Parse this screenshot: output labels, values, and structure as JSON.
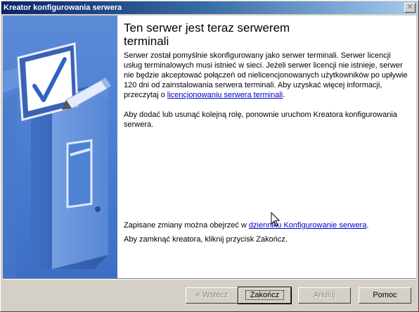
{
  "window": {
    "title": "Kreator konfigurowania serwera"
  },
  "main": {
    "title_line1": "Ten serwer jest teraz serwerem",
    "title_line2": "terminali",
    "para1_text": "Serwer został pomyślnie skonfigurowany jako serwer terminali. Serwer licencji usług terminalowych musi istnieć w sieci. Jeżeli serwer licencji nie istnieje, serwer nie będzie akceptować połączeń od nielicencjonowanych użytkowników po upływie 120 dni od zainstalowania serwera terminali. Aby uzyskać więcej informacji, przeczytaj o ",
    "para1_link": "licencjonowaniu serwera terminali",
    "para1_end": ".",
    "para2": "Aby dodać lub usunąć kolejną rolę, ponownie uruchom Kreatora konfigurowania serwera.",
    "log_text": "Zapisane zmiany można obejrzeć w ",
    "log_link": "dzienniku Konfigurowanie serwera",
    "log_end": ".",
    "close_text": "Aby zamknąć kreatora, kliknij przycisk Zakończ."
  },
  "buttons": {
    "back": "< Wstecz",
    "finish": "Zakończ",
    "cancel": "Anuluj",
    "help": "Pomoc"
  },
  "colors": {
    "title_bar_start": "#0a246a",
    "side_panel": "#4a7ed2",
    "link": "#0000cc"
  },
  "icons": [
    "close-icon",
    "server-checkmark-illustration",
    "mouse-cursor-icon"
  ]
}
